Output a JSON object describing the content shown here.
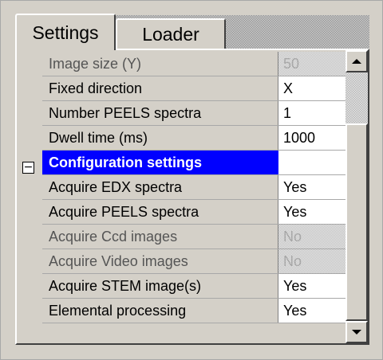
{
  "tabs": [
    {
      "label": "Settings",
      "active": true
    },
    {
      "label": "Loader",
      "active": false
    }
  ],
  "properties": [
    {
      "name": "Image size (Y)",
      "value": "50",
      "disabled": true
    },
    {
      "name": "Fixed direction",
      "value": "X"
    },
    {
      "name": "Number PEELS spectra",
      "value": "1"
    },
    {
      "name": "Dwell time (ms)",
      "value": "1000"
    },
    {
      "name": "Configuration settings",
      "value": "",
      "section": true,
      "expanded": true
    },
    {
      "name": "Acquire EDX spectra",
      "value": "Yes"
    },
    {
      "name": "Acquire PEELS spectra",
      "value": "Yes"
    },
    {
      "name": "Acquire Ccd images",
      "value": "No",
      "disabled": true
    },
    {
      "name": "Acquire Video images",
      "value": "No",
      "disabled": true
    },
    {
      "name": "Acquire STEM image(s)",
      "value": "Yes"
    },
    {
      "name": "Elemental processing",
      "value": "Yes"
    }
  ],
  "collapse_toggle": "−",
  "colors": {
    "section_highlight": "#0000ff",
    "panel_face": "#d4d0c8"
  },
  "icons": {
    "scroll_up": "scroll-up-arrow-icon",
    "scroll_down": "scroll-down-arrow-icon",
    "collapse": "minus-box-icon"
  }
}
